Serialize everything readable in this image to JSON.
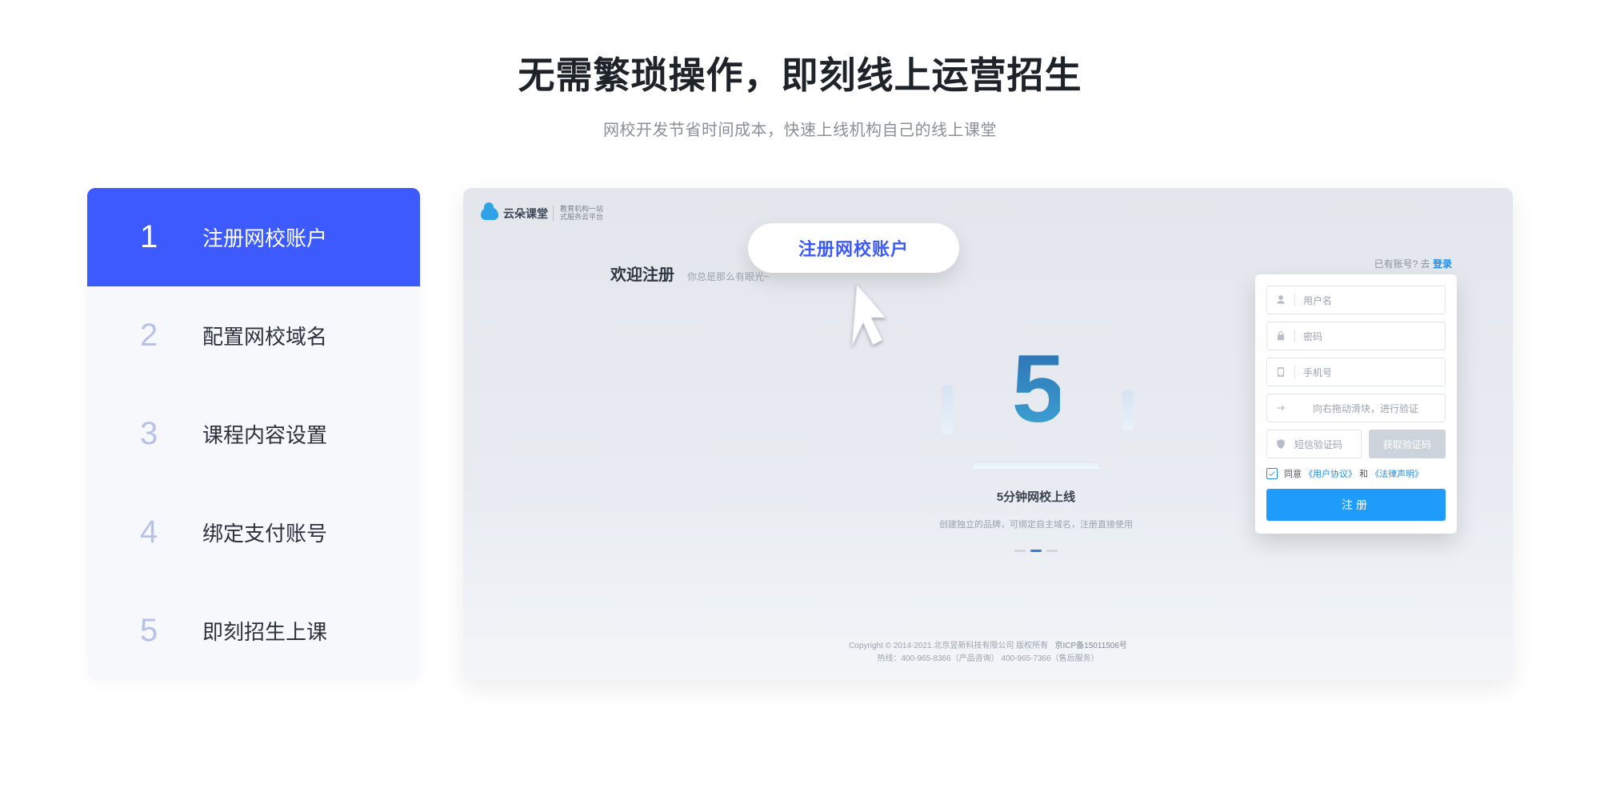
{
  "headline": "无需繁琐操作，即刻线上运营招生",
  "subheadline": "网校开发节省时间成本，快速上线机构自己的线上课堂",
  "steps": [
    {
      "num": "1",
      "label": "注册网校账户",
      "active": true
    },
    {
      "num": "2",
      "label": "配置网校域名",
      "active": false
    },
    {
      "num": "3",
      "label": "课程内容设置",
      "active": false
    },
    {
      "num": "4",
      "label": "绑定支付账号",
      "active": false
    },
    {
      "num": "5",
      "label": "即刻招生上课",
      "active": false
    }
  ],
  "callout": "注册网校账户",
  "preview": {
    "brand_name": "云朵课堂",
    "brand_tag_line1": "教育机构一站",
    "brand_tag_line2": "式服务云平台",
    "reg_title": "欢迎注册",
    "reg_sub": "你总是那么有眼光~",
    "illus_title": "5分钟网校上线",
    "illus_desc": "创建独立的品牌，可绑定自主域名，注册直接使用",
    "big5": "5",
    "login_hint_prefix": "已有账号? 去 ",
    "login_hint_link": "登录",
    "fields": {
      "username": "用户名",
      "password": "密码",
      "phone": "手机号",
      "slider": "向右拖动滑块，进行验证",
      "sms_code": "短信验证码",
      "get_code": "获取验证码"
    },
    "agree_prefix": "同意",
    "agree_user": "《用户协议》",
    "agree_and": "和",
    "agree_law": "《法律声明》",
    "submit": "注册",
    "footer": {
      "line1_a": "Copyright © 2014-2021.北京昱新科技有限公司 版权所有",
      "line1_b": "京ICP备15011506号",
      "line2": "热线：400-965-8366（产品咨询）  400-965-7366（售后服务）"
    }
  }
}
